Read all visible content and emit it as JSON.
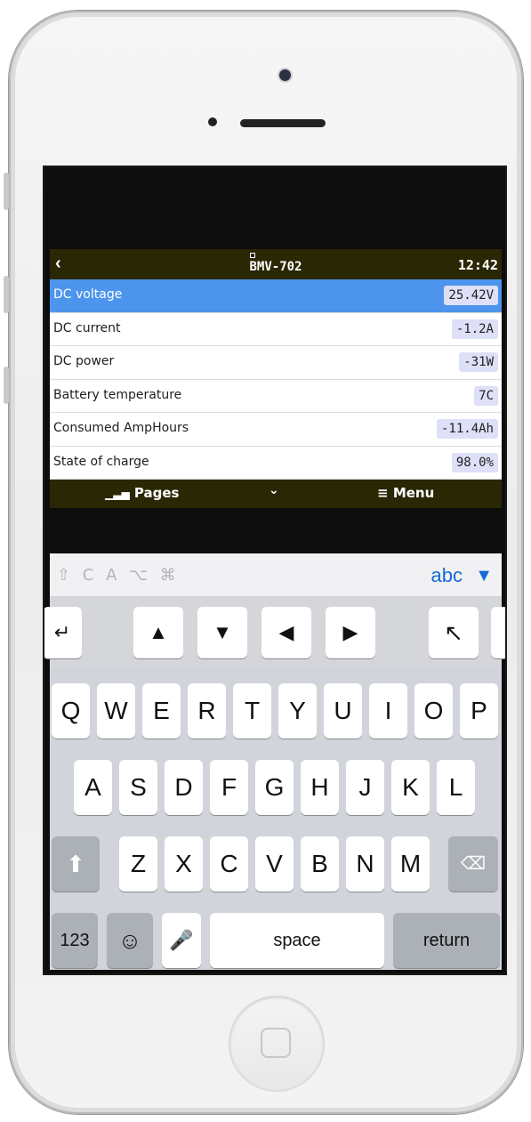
{
  "header": {
    "back_icon": "chevron-left-icon",
    "title": "BMV-702",
    "time": "12:42"
  },
  "rows": [
    {
      "label": "DC voltage",
      "value": "25.42V",
      "selected": true
    },
    {
      "label": "DC current",
      "value": "-1.2A"
    },
    {
      "label": "DC power",
      "value": "-31W"
    },
    {
      "label": "Battery temperature",
      "value": "7C"
    },
    {
      "label": "Consumed AmpHours",
      "value": "-11.4Ah"
    },
    {
      "label": "State of charge",
      "value": "98.0%"
    }
  ],
  "footer": {
    "pages_icon": "chart-icon",
    "pages_label": "Pages",
    "chevron": "chevron-down-icon",
    "menu_icon": "hamburger-icon",
    "menu_label": "Menu"
  },
  "keyboard": {
    "modifiers": "⇧ C A ⌥ ⌘",
    "abc_label": "abc",
    "row1": [
      "Q",
      "W",
      "E",
      "R",
      "T",
      "Y",
      "U",
      "I",
      "O",
      "P"
    ],
    "row2": [
      "A",
      "S",
      "D",
      "F",
      "G",
      "H",
      "J",
      "K",
      "L"
    ],
    "row3": [
      "Z",
      "X",
      "C",
      "V",
      "B",
      "N",
      "M"
    ],
    "numbers_label": "123",
    "space_label": "space",
    "return_label": "return"
  },
  "colors": {
    "header_bg": "#2a2704",
    "selection": "#4d95ec",
    "value_chip": "#dde0f7",
    "link_blue": "#1569d8"
  }
}
